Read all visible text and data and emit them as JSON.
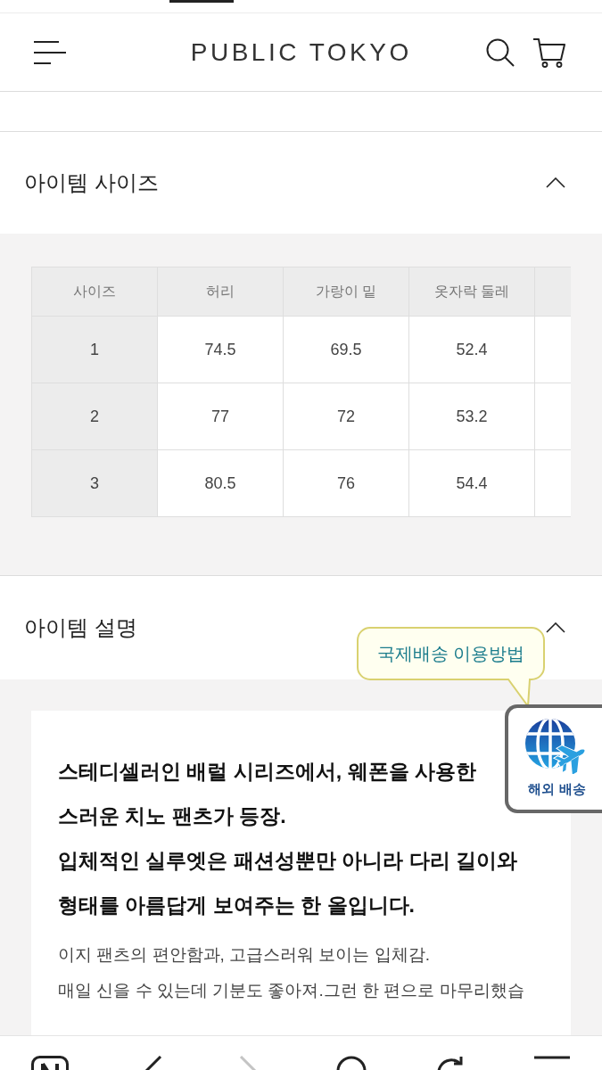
{
  "header": {
    "title": "PUBLIC TOKYO"
  },
  "sections": [
    {
      "kind": "size_table",
      "title": "아이템 사이즈",
      "expanded": true,
      "table": {
        "columns": [
          "사이즈",
          "허리",
          "가랑이 밑",
          "옷자락 둘레"
        ],
        "rows": [
          [
            "1",
            "74.5",
            "69.5",
            "52.4"
          ],
          [
            "2",
            "77",
            "72",
            "53.2"
          ],
          [
            "3",
            "80.5",
            "76",
            "54.4"
          ]
        ]
      }
    },
    {
      "kind": "description",
      "title": "아이템 설명",
      "expanded": true,
      "lead_paragraphs": [
        [
          "스테디셀러인 배럴 시리즈에서, 웨폰을 사용한",
          "스러운 치노 팬츠가 등장."
        ],
        [
          "입체적인 실루엣은 패션성뿐만 아니라 다리 길이와 형태를 아름답게 보여주는 한 올입니다."
        ]
      ],
      "body": [
        "이지 팬츠의 편안함과, 고급스러워 보이는 입체감.",
        "매일 신을 수 있는데 기분도 좋아져.그런 한 편으로 마무리했습"
      ]
    }
  ],
  "shipping_tooltip": {
    "text": "국제배송 이용방법"
  },
  "shipping_badge": {
    "label": "해외 배송"
  },
  "toolbar": [
    {
      "kind": "tile",
      "disabled": false
    },
    {
      "kind": "back",
      "disabled": false
    },
    {
      "kind": "forward",
      "disabled": true
    },
    {
      "kind": "circle",
      "disabled": false
    },
    {
      "kind": "refresh",
      "disabled": false
    },
    {
      "kind": "menu",
      "disabled": false
    }
  ]
}
